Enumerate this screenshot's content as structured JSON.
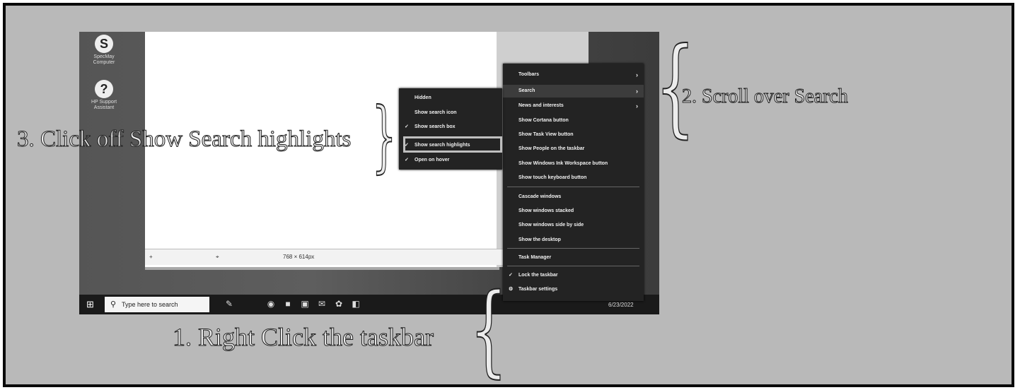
{
  "desktop_icons": [
    {
      "label": "SpecMay Computer",
      "icon": "app-logo-icon",
      "glyph": "S"
    },
    {
      "label": "HP Support Assistant",
      "icon": "help-icon",
      "glyph": "?"
    }
  ],
  "app_statusbar": {
    "add": "+",
    "cursor": "⌖",
    "size": "768 × 614px"
  },
  "taskbar": {
    "start_icon": "windows-logo-icon",
    "search_placeholder": "Type here to search",
    "pinned": [
      "edge-icon",
      "store-icon",
      "calendar-icon",
      "mail-icon",
      "photos-icon",
      "files-icon"
    ],
    "date": "6/23/2022"
  },
  "taskbar_menu": {
    "items": [
      {
        "label": "Toolbars",
        "submenu": true
      },
      {
        "label": "Search",
        "submenu": true
      },
      {
        "label": "News and interests",
        "submenu": true
      },
      {
        "label": "Show Cortana button"
      },
      {
        "label": "Show Task View button"
      },
      {
        "label": "Show People on the taskbar"
      },
      {
        "label": "Show Windows Ink Workspace button"
      },
      {
        "label": "Show touch keyboard button"
      },
      {
        "label": "Cascade windows"
      },
      {
        "label": "Show windows stacked"
      },
      {
        "label": "Show windows side by side"
      },
      {
        "label": "Show the desktop"
      },
      {
        "label": "Task Manager"
      },
      {
        "label": "Lock the taskbar",
        "checked": true
      },
      {
        "label": "Taskbar settings",
        "icon": "gear-icon"
      }
    ]
  },
  "search_submenu": {
    "items": [
      {
        "label": "Hidden"
      },
      {
        "label": "Show search icon"
      },
      {
        "label": "Show search box",
        "checked": true
      },
      {
        "label": "Show search highlights",
        "checked": true
      },
      {
        "label": "Open on hover",
        "checked": true
      }
    ]
  },
  "annotations": {
    "step1": "1. Right Click the taskbar",
    "step2": "2. Scroll over Search",
    "step3": "3. Click off Show Search highlights"
  }
}
